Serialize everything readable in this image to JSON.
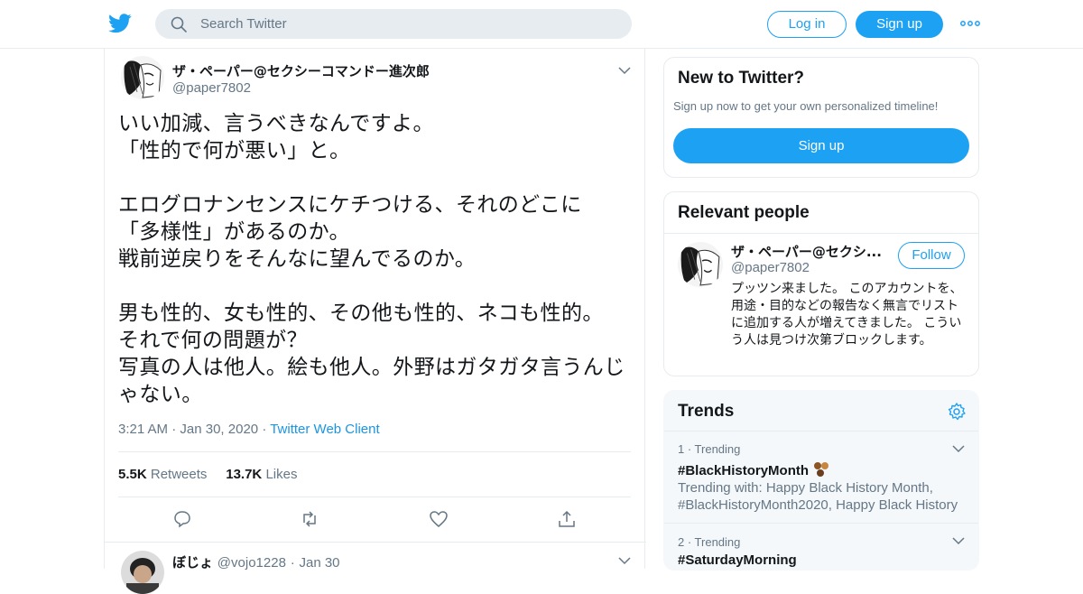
{
  "search": {
    "placeholder": "Search Twitter"
  },
  "header": {
    "login_label": "Log in",
    "signup_label": "Sign up"
  },
  "tweet": {
    "author_name": "ザ・ペーパー@セクシーコマンドー進次郎",
    "author_handle": "@paper7802",
    "text": "いい加減、言うべきなんですよ。\n「性的で何が悪い」と。\n\nエログロナンセンスにケチつける、それのどこに\n「多様性」があるのか。\n戦前逆戻りをそんなに望んでるのか。\n\n男も性的、女も性的、その他も性的、ネコも性的。\nそれで何の問題が？\n写真の人は他人。絵も他人。外野はガタガタ言うんじ\nゃない。",
    "time": "3:21 AM",
    "date": "Jan 30, 2020",
    "client": "Twitter Web Client",
    "retweet_count": "5.5K",
    "retweet_label": "Retweets",
    "like_count": "13.7K",
    "like_label": "Likes"
  },
  "reply": {
    "author_name": "ぼじょ",
    "author_handle": "@vojo1228",
    "date": "Jan 30"
  },
  "new_to_twitter": {
    "title": "New to Twitter?",
    "subtitle": "Sign up now to get your own personalized timeline!",
    "button_label": "Sign up"
  },
  "relevant_people": {
    "title": "Relevant people",
    "name": "ザ・ペーパー@セクシ...",
    "handle": "@paper7802",
    "follow_label": "Follow",
    "bio": "プッツン来ました。 このアカウントを、用途・目的などの報告なく無言でリストに追加する人が増えてきました。 こういう人は見つけ次第ブロックします。"
  },
  "trends": {
    "title": "Trends",
    "items": [
      {
        "rank": "1 · Trending",
        "name": "#BlackHistoryMonth",
        "desc": "Trending with: Happy Black History Month, #BlackHistoryMonth2020, Happy Black History"
      },
      {
        "rank": "2 · Trending",
        "name": "#SaturdayMorning"
      }
    ]
  },
  "colors": {
    "accent": "#1da1f2",
    "link": "#1b95e0",
    "muted": "#657786",
    "border": "#e6ecf0"
  }
}
